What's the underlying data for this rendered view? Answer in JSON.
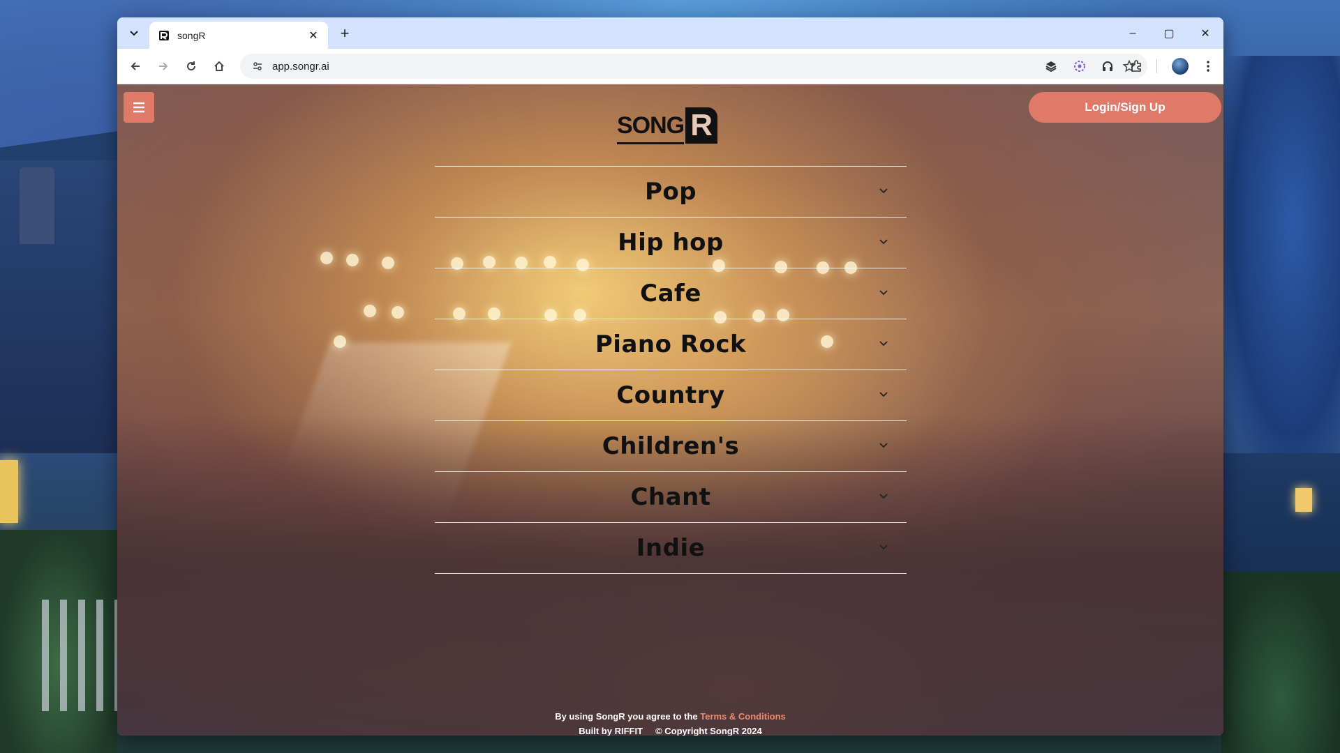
{
  "browser": {
    "tab_title": "songR",
    "url": "app.songr.ai",
    "new_tab_symbol": "+",
    "window_controls": {
      "minimize": "–",
      "maximize": "▢",
      "close": "✕"
    }
  },
  "header": {
    "logo_text": "SONG",
    "logo_letter": "R",
    "login_label": "Login/Sign Up"
  },
  "genres": [
    {
      "label": "Pop"
    },
    {
      "label": "Hip hop"
    },
    {
      "label": "Cafe"
    },
    {
      "label": "Piano Rock"
    },
    {
      "label": "Country"
    },
    {
      "label": "Children's"
    },
    {
      "label": "Chant"
    },
    {
      "label": "Indie"
    }
  ],
  "footer": {
    "agree_text": "By using SongR you agree to the ",
    "terms_link": "Terms & Conditions",
    "built_by": "Built by RIFFIT",
    "copyright": "© Copyright SongR 2024"
  },
  "colors": {
    "accent": "#e07a68",
    "link": "#f08a6c",
    "tabbar": "#d3e3fd"
  }
}
